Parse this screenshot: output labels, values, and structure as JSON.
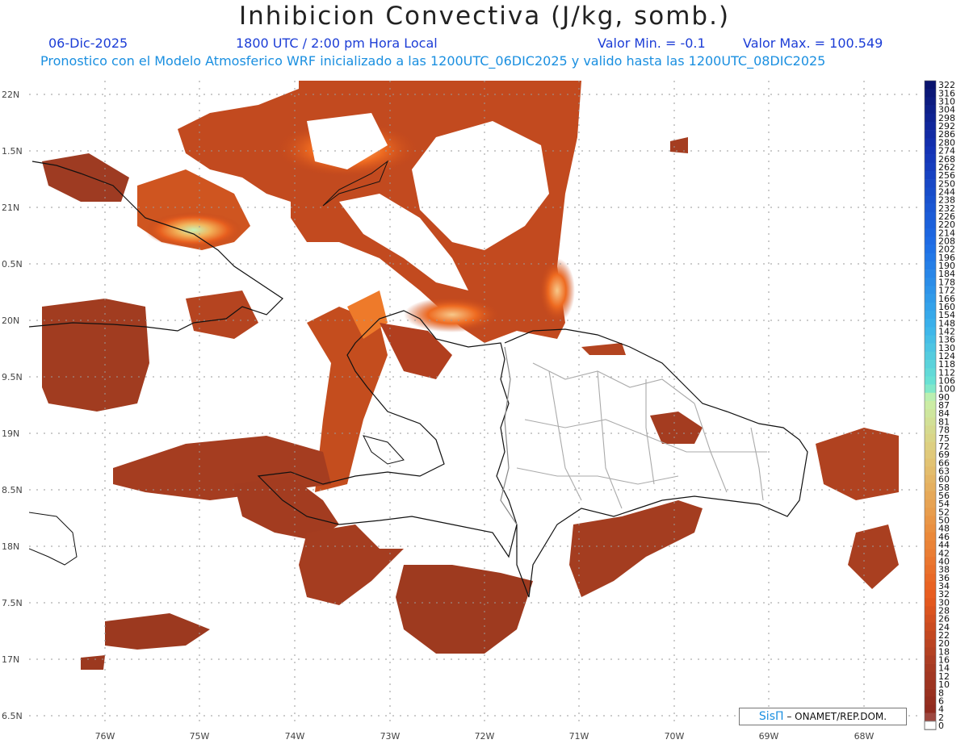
{
  "header": {
    "title": "Inhibicion Convectiva (J/kg, somb.)",
    "date": "06-Dic-2025",
    "time": "1800 UTC / 2:00 pm Hora Local",
    "valmin": "Valor Min. = -0.1",
    "valmax": "Valor Max. = 100.549",
    "forecast": "Pronostico con el Modelo Atmosferico WRF inicializado a las 1200UTC_06DIC2025 y valido hasta las  1200UTC_08DIC2025"
  },
  "axes": {
    "lon_labels": [
      "76W",
      "75W",
      "74W",
      "73W",
      "72W",
      "71W",
      "70W",
      "69W",
      "68W"
    ],
    "lat_labels": [
      "22N",
      "1.5N",
      "21N",
      "0.5N",
      "20N",
      "9.5N",
      "19N",
      "8.5N",
      "18N",
      "7.5N",
      "17N",
      "6.5N"
    ]
  },
  "colorbar": {
    "labels": [
      "322",
      "316",
      "310",
      "304",
      "298",
      "292",
      "286",
      "280",
      "274",
      "268",
      "262",
      "256",
      "250",
      "244",
      "238",
      "232",
      "226",
      "220",
      "214",
      "208",
      "202",
      "196",
      "190",
      "184",
      "178",
      "172",
      "166",
      "160",
      "154",
      "148",
      "142",
      "136",
      "130",
      "124",
      "118",
      "112",
      "106",
      "100",
      "90",
      "87",
      "84",
      "81",
      "78",
      "75",
      "72",
      "69",
      "66",
      "63",
      "60",
      "58",
      "56",
      "54",
      "52",
      "50",
      "48",
      "46",
      "44",
      "42",
      "40",
      "38",
      "36",
      "34",
      "32",
      "30",
      "28",
      "26",
      "24",
      "22",
      "20",
      "18",
      "16",
      "14",
      "12",
      "10",
      "8",
      "6",
      "4",
      "2",
      "0"
    ]
  },
  "credit": {
    "brand": "SisΠ",
    "text": "– ONAMET/REP.DOM."
  },
  "colors": {
    "field_dark": "#9b3a1f",
    "field_mid": "#c4471c",
    "field_bright": "#ee6a20",
    "field_peak": "#b8f0b0",
    "border": "#111111",
    "province": "#a8a8a8"
  }
}
